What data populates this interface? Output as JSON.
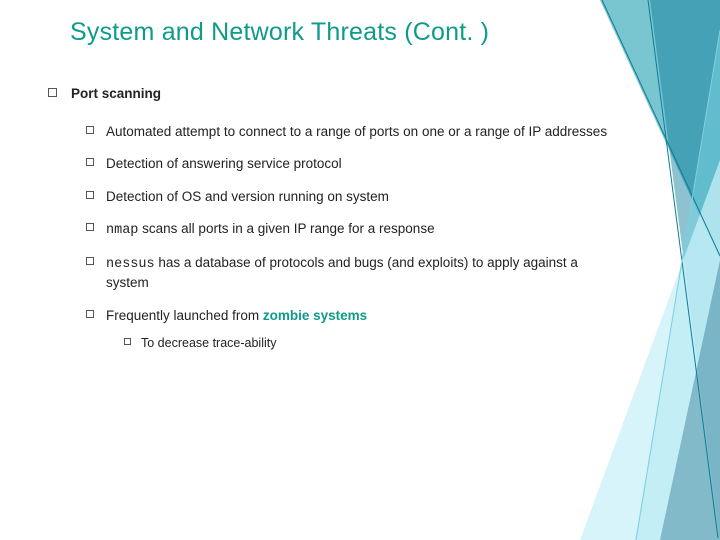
{
  "title": "System and Network Threats (Cont. )",
  "b1": {
    "label": "Port scanning",
    "items": [
      {
        "text": "Automated attempt to connect to a range of ports on one or a range of IP addresses"
      },
      {
        "text": "Detection of answering service protocol"
      },
      {
        "text": "Detection of OS and version running on system"
      },
      {
        "code": "nmap",
        "rest": " scans all ports in a given IP range for a response"
      },
      {
        "code": "nessus",
        "rest": " has a database of protocols and bugs (and exploits) to apply against a system"
      },
      {
        "pre": "Frequently launched from ",
        "accent": "zombie systems",
        "sub": [
          {
            "text": "To decrease trace-ability"
          }
        ]
      }
    ]
  },
  "colors": {
    "accent": "#0e9b8a"
  }
}
